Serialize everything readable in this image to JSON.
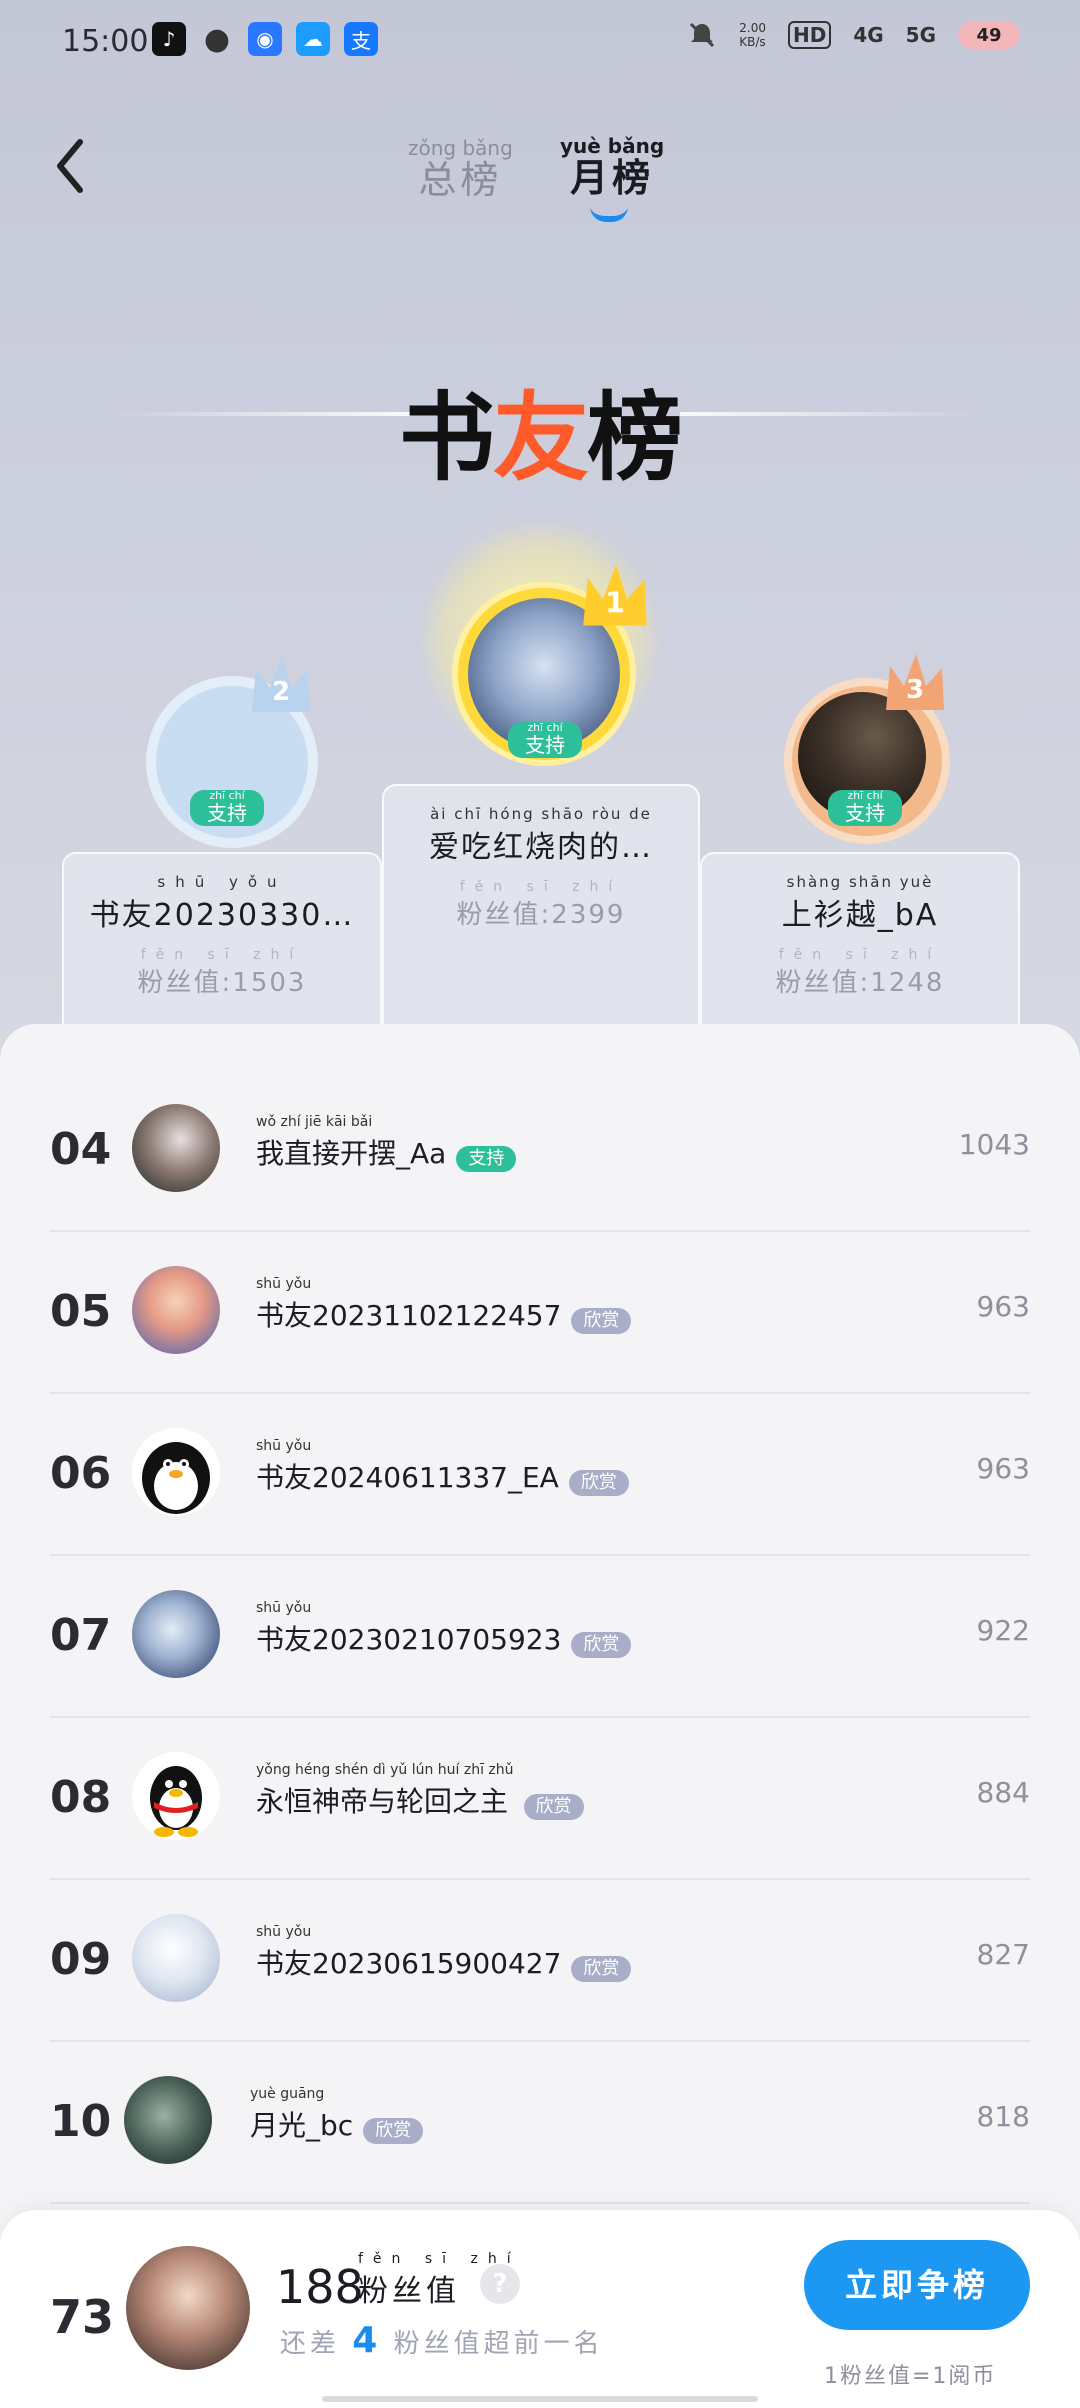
{
  "status_bar": {
    "time": "15:00",
    "net_speed": "2.00\nKB/s",
    "hd": "HD",
    "net1": "4G",
    "net2": "5G",
    "battery": "49"
  },
  "header": {
    "tabs": [
      {
        "pinyin": "zǒng bǎng",
        "label": "总榜"
      },
      {
        "pinyin": "yuè bǎng",
        "label": "月榜"
      }
    ],
    "title_part1": "书",
    "title_accent": "友",
    "title_part2": "榜"
  },
  "podium": {
    "first": {
      "rank": "1",
      "name_pinyin": "ài  chī  hóng shāo ròu  de",
      "name": "爱吃红烧肉的…",
      "fans_pinyin": "fěn  sī  zhí",
      "fans_label": "粉丝值",
      "value": ":2399",
      "badge_pinyin": "zhī chí",
      "badge": "支持"
    },
    "second": {
      "rank": "2",
      "name_pinyin": "shū yǒu",
      "name": "书友20230330…",
      "fans_pinyin": "fěn  sī  zhí",
      "fans_label": "粉丝值",
      "value": ":1503",
      "badge_pinyin": "zhī chí",
      "badge": "支持"
    },
    "third": {
      "rank": "3",
      "name_pinyin": "shàng shān yuè",
      "name": "上衫越_bA",
      "fans_pinyin": "fěn  sī  zhí",
      "fans_label": "粉丝值",
      "value": ":1248",
      "badge_pinyin": "zhī chí",
      "badge": "支持"
    }
  },
  "list": [
    {
      "rank": "04",
      "pinyin": "wǒ zhí jiē kāi bǎi",
      "name": "我直接开摆_Aa",
      "tag": "支持",
      "tag_type": "support",
      "value": "1043"
    },
    {
      "rank": "05",
      "pinyin": "shū yǒu",
      "name": "书友20231102122457",
      "tag": "欣赏",
      "tag_type": "admire",
      "value": "963"
    },
    {
      "rank": "06",
      "pinyin": "shū yǒu",
      "name": "书友20240611337_EA",
      "tag": "欣赏",
      "tag_type": "admire",
      "value": "963"
    },
    {
      "rank": "07",
      "pinyin": "shū yǒu",
      "name": "书友20230210705923",
      "tag": "欣赏",
      "tag_type": "admire",
      "value": "922"
    },
    {
      "rank": "08",
      "pinyin": "yǒng héng shén dì yǔ lún huí zhī zhǔ",
      "name": "永恒神帝与轮回之主",
      "tag": "欣赏",
      "tag_type": "admire",
      "value": "884"
    },
    {
      "rank": "09",
      "pinyin": "shū yǒu",
      "name": "书友20230615900427",
      "tag": "欣赏",
      "tag_type": "admire",
      "value": "827"
    },
    {
      "rank": "10",
      "pinyin": "yuè guāng",
      "name": "月光_bc",
      "tag": "欣赏",
      "tag_type": "admire",
      "value": "818"
    }
  ],
  "me": {
    "rank": "73",
    "value": "188",
    "label_pinyin": "fěn  sī  zhí",
    "label": "粉丝值",
    "help": "?",
    "gap_pre": "还差",
    "gap_num": "4",
    "gap_post": "粉丝值超前一名",
    "button": "立即争榜",
    "note": "1粉丝值=1阅币"
  },
  "colors": {
    "accent": "#1d98f2",
    "support": "#2dbf9a",
    "admire": "#a8aec8",
    "title_accent": "#ff5a2a"
  }
}
